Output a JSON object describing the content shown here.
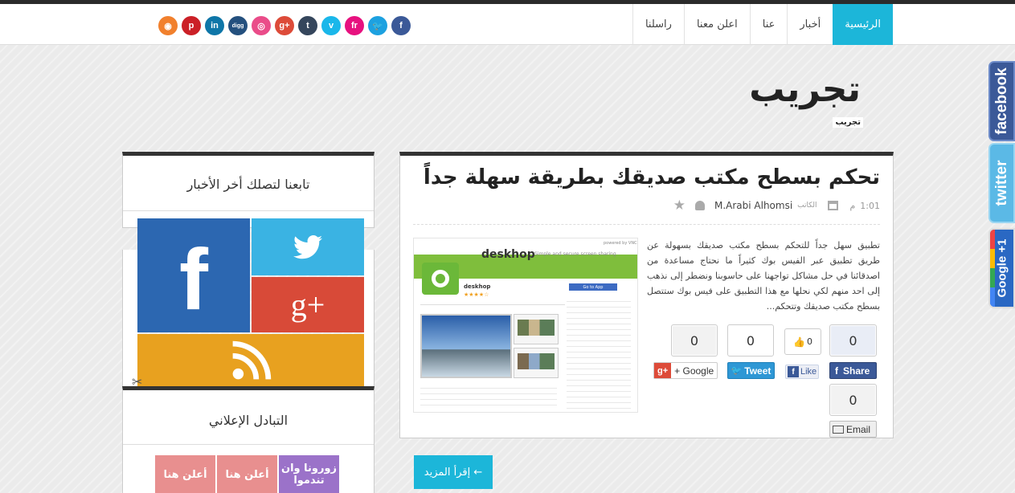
{
  "nav": {
    "items": [
      {
        "label": "الرئيسية",
        "active": true
      },
      {
        "label": "أخبار"
      },
      {
        "label": "عنا"
      },
      {
        "label": "اعلن معنا"
      },
      {
        "label": "راسلنا"
      }
    ]
  },
  "social_icons": [
    {
      "icon": "facebook-icon",
      "glyph": "f",
      "color": "#3b5998"
    },
    {
      "icon": "twitter-icon",
      "glyph": "🐦",
      "color": "#1da1e0"
    },
    {
      "icon": "flickr-icon",
      "glyph": "fr",
      "color": "#e7117f"
    },
    {
      "icon": "vimeo-icon",
      "glyph": "v",
      "color": "#1ab7ea"
    },
    {
      "icon": "tumblr-icon",
      "glyph": "t",
      "color": "#35465c"
    },
    {
      "icon": "google-plus-icon",
      "glyph": "g+",
      "color": "#dd4b39"
    },
    {
      "icon": "dribbble-icon",
      "glyph": "◎",
      "color": "#ea4c89"
    },
    {
      "icon": "digg-icon",
      "glyph": "digg",
      "color": "#24507e"
    },
    {
      "icon": "linkedin-icon",
      "glyph": "in",
      "color": "#0e76a8"
    },
    {
      "icon": "pinterest-icon",
      "glyph": "p",
      "color": "#cb2027"
    },
    {
      "icon": "rss-icon",
      "glyph": "◉",
      "color": "#f1802d"
    }
  ],
  "page": {
    "title": "تجريب",
    "breadcrumb": "تجريب"
  },
  "side_tabs": {
    "facebook": "facebook",
    "twitter": "twitter",
    "google": "Google +1"
  },
  "article": {
    "title": "تحكم بسطح مكتب صديقك بطريقة سهلة جداً",
    "time": "1:01",
    "time_suffix": "م",
    "author_label": "الكاتب",
    "author": "M.Arabi Alhomsi",
    "excerpt": "تطبيق سهل جداً للتحكم بسطح مكتب صديقك بسهولة عن طريق تطبيق عبر الفيس بوك كثيراً ما نحتاج مساعدة من اصدقائنا في حل مشاكل تواجهنا على حاسوبنا ونضطر إلى نذهب إلى احد منهم لكي نحلها مع هذا التطبيق على فيس بوك ستتصل بسطح مكتب صديقك وتتحكم...",
    "thumbnail": {
      "brand": "deskhop",
      "tagline": "Simple and secure screen sharing",
      "app_name": "deskhop",
      "go_button": "Go to App",
      "powered": "powered by VNC"
    },
    "share": {
      "google_count": "0",
      "google_label": "+ Google",
      "tweet_count": "0",
      "tweet_label": "Tweet",
      "like_count": "0",
      "like_label": "Like",
      "fb_share_count": "0",
      "fb_share_label": "Share",
      "email_count": "0",
      "email_label": "Email"
    },
    "read_more": "إقرأ المزيد ←"
  },
  "sidebar": {
    "follow_title": "تابعنا لتصلك أخر الأخبار",
    "ads_title": "التبادل الإعلاني",
    "ads": [
      {
        "label": "أعلن هنا",
        "color": "#e88f8f"
      },
      {
        "label": "أعلن هنا",
        "color": "#e88f8f"
      },
      {
        "label": "زورونا وان تندموا",
        "color": "#9b72c9"
      }
    ]
  },
  "colors": {
    "accent": "#1cb6d9",
    "facebook": "#2c67b1",
    "twitter": "#3ab3e3",
    "google_plus": "#d84a38",
    "rss": "#e8a11f"
  }
}
